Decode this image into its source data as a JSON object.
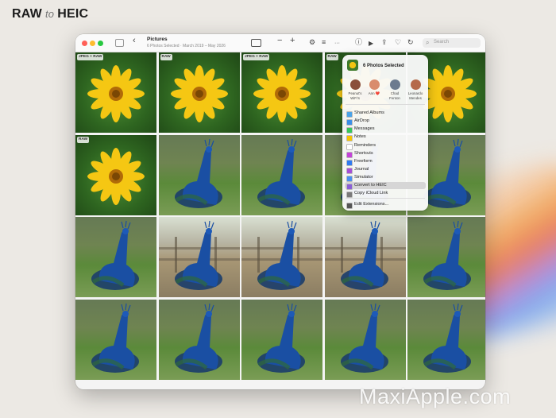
{
  "branding": {
    "text_left": "RAW",
    "text_mid": "to",
    "text_right": "HEIC",
    "watermark": "MaxiApple.com"
  },
  "window": {
    "title": "Pictures",
    "subtitle": "6 Photos Selected · March 2019 – May 2026",
    "search_placeholder": "Search",
    "icons": {
      "back": "‹",
      "zoom_out": "−",
      "zoom_in": "+",
      "adjust": "⚙",
      "filter": "≡",
      "more": "···",
      "info": "ⓘ",
      "play": "▶",
      "share": "⇪",
      "favorite": "♡",
      "rotate": "↻",
      "search": "⌕"
    }
  },
  "grid": {
    "rows": [
      [
        {
          "kind": "flower",
          "badge": "JPEG + RAW"
        },
        {
          "kind": "flower",
          "badge": "RAW"
        },
        {
          "kind": "flower",
          "badge": "JPEG + RAW"
        },
        {
          "kind": "flower",
          "badge": "RAW"
        },
        {
          "kind": "flower",
          "badge": ""
        }
      ],
      [
        {
          "kind": "flower",
          "badge": "RAW"
        },
        {
          "kind": "bird-grass",
          "badge": ""
        },
        {
          "kind": "bird-grass",
          "badge": ""
        },
        {
          "kind": "bird-grass",
          "badge": ""
        },
        {
          "kind": "bird-grass",
          "badge": ""
        }
      ],
      [
        {
          "kind": "bird-grass",
          "badge": ""
        },
        {
          "kind": "bird-fence",
          "badge": ""
        },
        {
          "kind": "bird-fence",
          "badge": ""
        },
        {
          "kind": "bird-fence",
          "badge": ""
        },
        {
          "kind": "bird-grass",
          "badge": ""
        }
      ],
      [
        {
          "kind": "bird-grass",
          "badge": ""
        },
        {
          "kind": "bird-grass",
          "badge": ""
        },
        {
          "kind": "bird-grass",
          "badge": ""
        },
        {
          "kind": "bird-grass",
          "badge": ""
        },
        {
          "kind": "bird-grass",
          "badge": ""
        }
      ]
    ]
  },
  "share_popup": {
    "title": "6 Photos Selected",
    "contacts": [
      {
        "name_line1": "Peanut's",
        "name_line2": "WiFi's",
        "color": "#8a4f3b"
      },
      {
        "name_line1": "Ann ❤️",
        "name_line2": "",
        "color": "#d98c6d"
      },
      {
        "name_line1": "Chad",
        "name_line2": "Fenton",
        "color": "#6c7b8f"
      },
      {
        "name_line1": "Leonardo",
        "name_line2": "Mendes",
        "color": "#b56a4a"
      }
    ],
    "items": [
      {
        "label": "Shared Albums",
        "color": "#4aa3e8",
        "selected": false
      },
      {
        "label": "AirDrop",
        "color": "#3a8fe8",
        "selected": false
      },
      {
        "label": "Messages",
        "color": "#35c759",
        "selected": false
      },
      {
        "label": "Notes",
        "color": "#f5c400",
        "selected": false
      },
      {
        "label": "Reminders",
        "color": "#ffffff",
        "selected": false
      },
      {
        "label": "Shortcuts",
        "color": "#c444d8",
        "selected": false
      },
      {
        "label": "Freeform",
        "color": "#2f7af0",
        "selected": false
      },
      {
        "label": "Journal",
        "color": "#a64fd6",
        "selected": false
      },
      {
        "label": "Simulator",
        "color": "#4a8ff0",
        "selected": false
      },
      {
        "label": "Convert to HEIC",
        "color": "#8a5fd6",
        "selected": true
      },
      {
        "label": "Copy iCloud Link",
        "color": "#7a7a7a",
        "selected": false
      },
      {
        "label": "Edit Extensions...",
        "color": "#555555",
        "selected": false
      }
    ]
  }
}
